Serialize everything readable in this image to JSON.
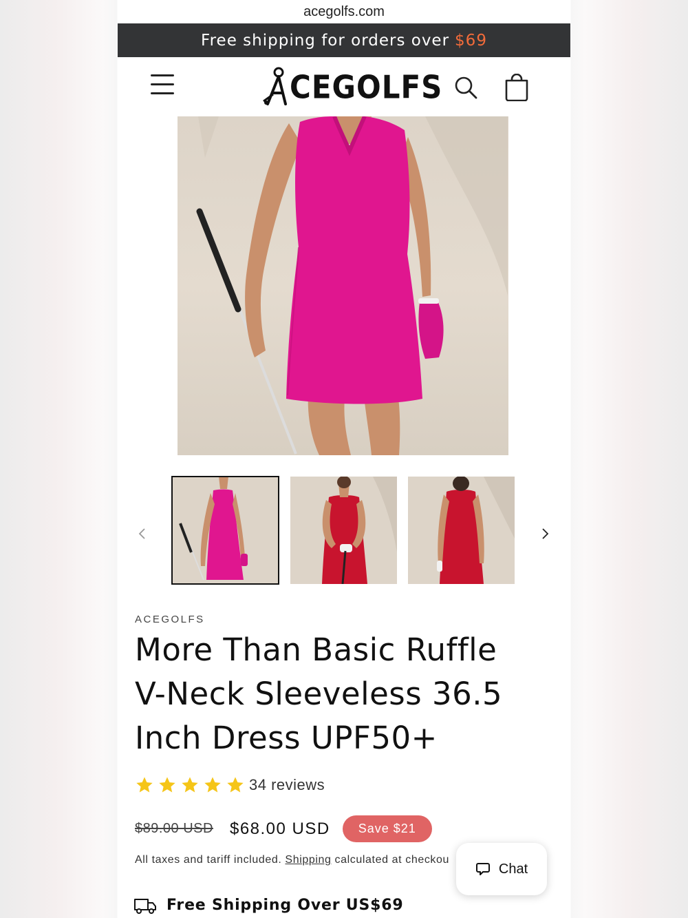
{
  "browser": {
    "url": "acegolfs.com"
  },
  "announcement": {
    "text": "Free shipping for orders over",
    "price": "$69"
  },
  "header": {
    "logo_text": "CEGOLFS"
  },
  "product": {
    "vendor": "ACEGOLFS",
    "title": "More Than Basic Ruffle V-Neck Sleeveless 36.5 Inch Dress UPF50+",
    "rating": {
      "stars": 5,
      "reviews_label": "34 reviews"
    },
    "price": {
      "compare_at": "$89.00 USD",
      "sale": "$68.00 USD",
      "badge": "Save $21"
    },
    "tax_note": {
      "before": "All taxes and tariff included.",
      "link": "Shipping",
      "after": "calculated at checkou"
    },
    "shipping_banner": "Free Shipping Over US$69"
  },
  "chat": {
    "label": "Chat"
  },
  "colors": {
    "announcement_bg": "#333436",
    "announcement_price": "#f26b3a",
    "dress_pink": "#e0168f",
    "dress_red": "#c8142e",
    "badge": "#e06464",
    "star": "#f5c518"
  },
  "gallery": {
    "thumbnails": [
      "pink-dress-front",
      "red-dress-front",
      "red-dress-back"
    ],
    "active_index": 0
  }
}
